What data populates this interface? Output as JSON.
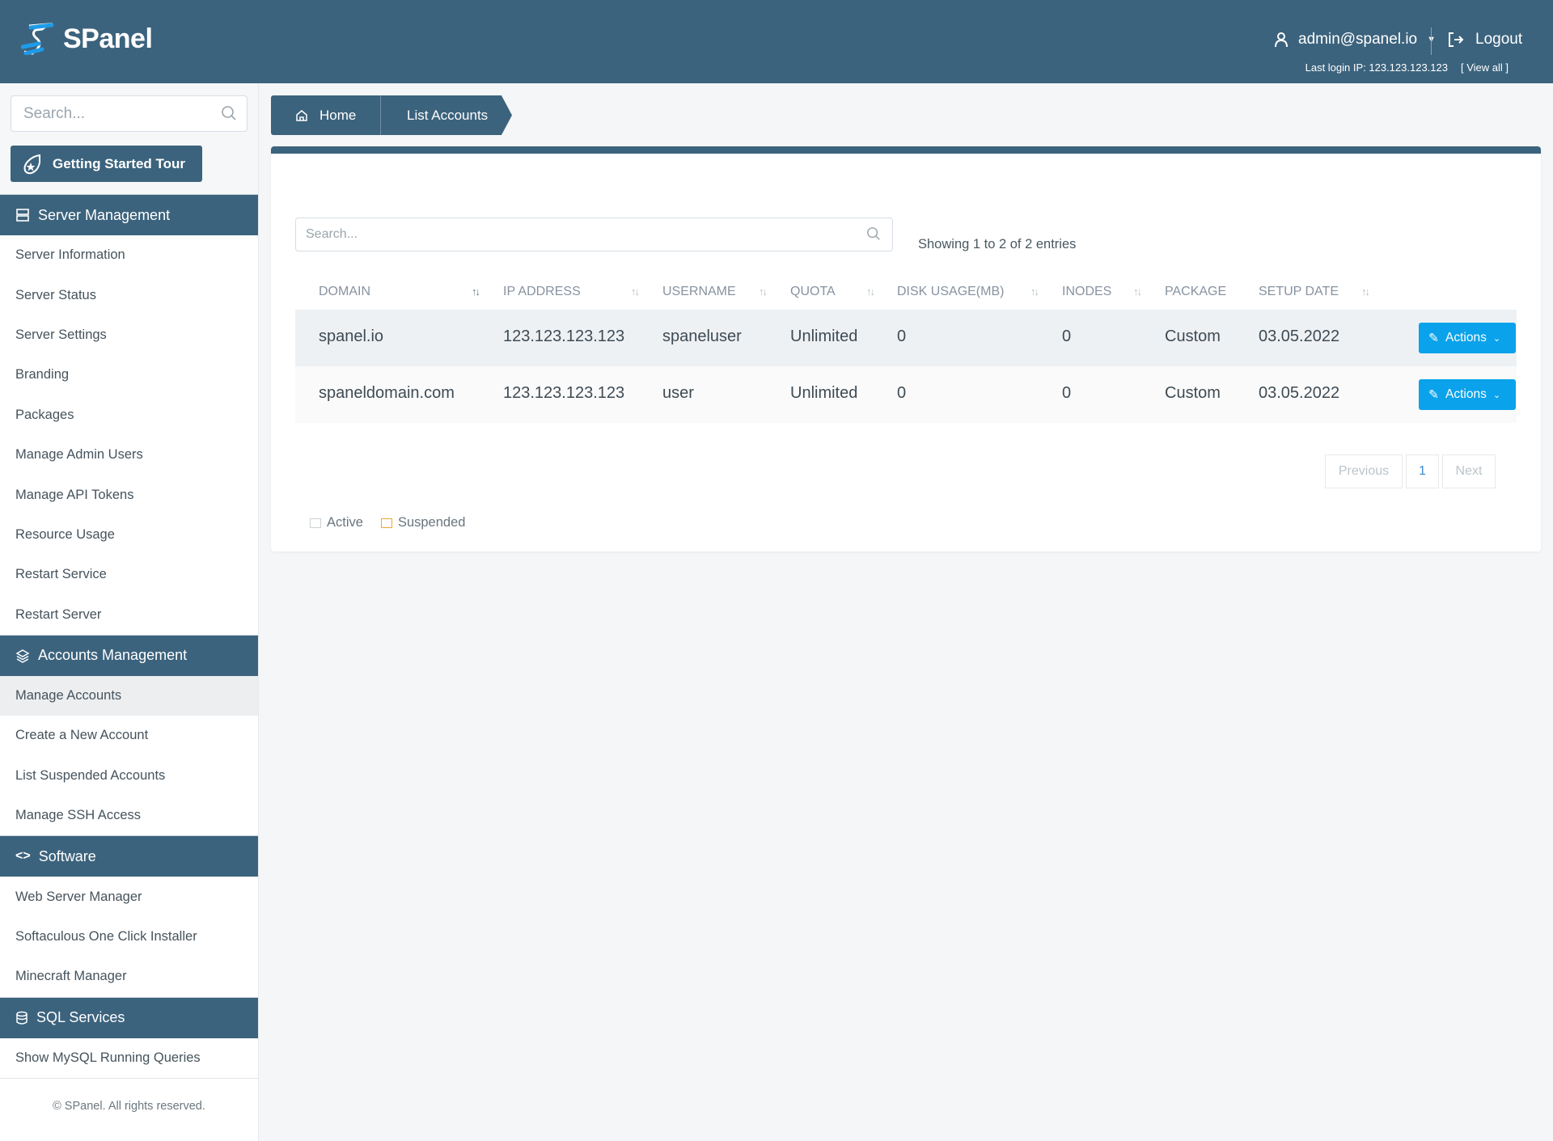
{
  "header": {
    "brand": "SPanel",
    "user": "admin@spanel.io",
    "logout": "Logout",
    "last_login": "Last login IP: 123.123.123.123",
    "view_all": "[ View all ]"
  },
  "sidebar": {
    "search_placeholder": "Search...",
    "tour": "Getting Started Tour",
    "sections": [
      {
        "title": "Server Management",
        "items": [
          "Server Information",
          "Server Status",
          "Server Settings",
          "Branding",
          "Packages",
          "Manage Admin Users",
          "Manage API Tokens",
          "Resource Usage",
          "Restart Service",
          "Restart Server"
        ]
      },
      {
        "title": "Accounts Management",
        "items": [
          "Manage Accounts",
          "Create a New Account",
          "List Suspended Accounts",
          "Manage SSH Access"
        ]
      },
      {
        "title": "Software",
        "items": [
          "Web Server Manager",
          "Softaculous One Click Installer",
          "Minecraft Manager"
        ]
      },
      {
        "title": "SQL Services",
        "items": [
          "Show MySQL Running Queries"
        ]
      }
    ],
    "active_item": "Manage Accounts",
    "footer": "© SPanel. All rights reserved."
  },
  "breadcrumb": {
    "home": "Home",
    "current": "List Accounts"
  },
  "table": {
    "search_placeholder": "Search...",
    "showing": "Showing 1 to 2 of 2 entries",
    "columns": [
      "DOMAIN",
      "IP ADDRESS",
      "USERNAME",
      "QUOTA",
      "DISK USAGE(MB)",
      "INODES",
      "PACKAGE",
      "SETUP DATE"
    ],
    "rows": [
      [
        "spanel.io",
        "123.123.123.123",
        "spaneluser",
        "Unlimited",
        "0",
        "0",
        "Custom",
        "03.05.2022"
      ],
      [
        "spaneldomain.com",
        "123.123.123.123",
        "user",
        "Unlimited",
        "0",
        "0",
        "Custom",
        "03.05.2022"
      ]
    ],
    "actions_label": "Actions",
    "pagination": {
      "previous": "Previous",
      "page": "1",
      "next": "Next"
    },
    "legend": {
      "active": "Active",
      "suspended": "Suspended"
    }
  },
  "colors": {
    "primary": "#3c637d",
    "accent": "#0aa2ea",
    "suspended": "#f0a830"
  }
}
